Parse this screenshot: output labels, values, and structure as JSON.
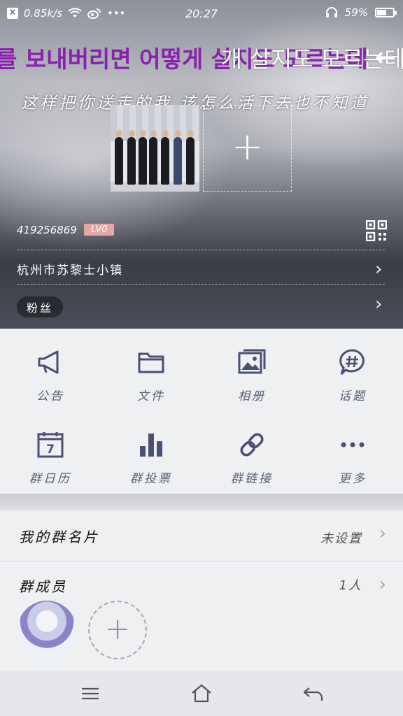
{
  "status": {
    "speed": "0.85k/s",
    "dots": "•••",
    "time": "20:27",
    "battery": "59%",
    "battery_level": 0.59
  },
  "header": {
    "ticker_korean": "를 보내버리면 어떻게 살지도 모르는데",
    "ticker_overlay": "개 살지도 모르는데",
    "subtitle": "这样把你送走的我 该怎么活下去也不知道",
    "group_id": "419256869",
    "level": "LV0",
    "location": "杭州市苏黎士小镇",
    "fans": "粉丝"
  },
  "features": [
    {
      "label": "公告",
      "icon": "megaphone-icon"
    },
    {
      "label": "文件",
      "icon": "folder-icon"
    },
    {
      "label": "相册",
      "icon": "album-icon"
    },
    {
      "label": "话题",
      "icon": "topic-icon"
    },
    {
      "label": "群日历",
      "icon": "calendar-icon"
    },
    {
      "label": "群投票",
      "icon": "vote-icon"
    },
    {
      "label": "群链接",
      "icon": "link-icon"
    },
    {
      "label": "更多",
      "icon": "more-icon"
    }
  ],
  "calendar_day": "7",
  "my_card": {
    "title": "我的群名片",
    "value": "未设置"
  },
  "members": {
    "title": "群成员",
    "count": "1人"
  },
  "colors": {
    "accent_icon": "#4a5074",
    "ticker_purple": "#8a1fb0",
    "level_badge": "#e8a5a5"
  }
}
